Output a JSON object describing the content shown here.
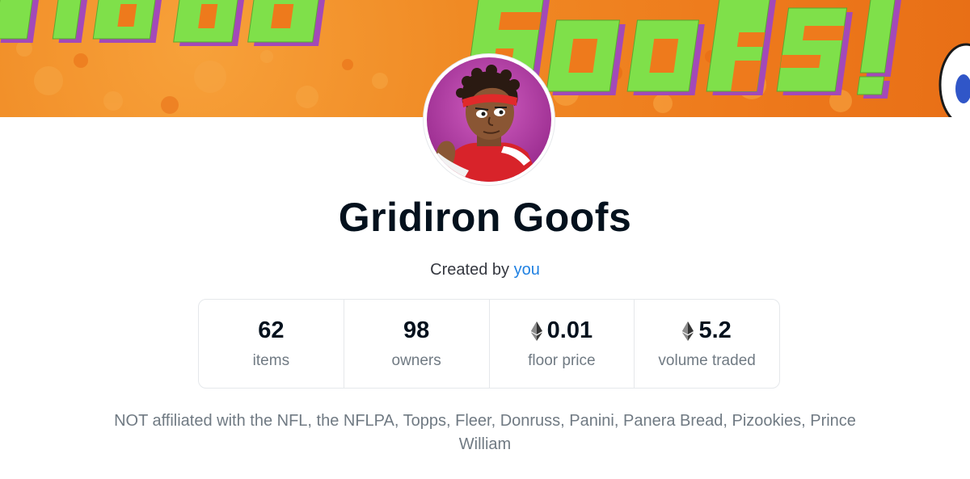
{
  "banner": {
    "text": "Gridiron Goofs!",
    "colors": {
      "background": "#ee7a1c",
      "letters": "#7fe04a",
      "shadow": "#a349b8"
    }
  },
  "collection": {
    "name": "Gridiron Goofs",
    "created_by_prefix": "Created by",
    "creator": "you"
  },
  "stats": [
    {
      "value": "62",
      "label": "items",
      "currency_icon": ""
    },
    {
      "value": "98",
      "label": "owners",
      "currency_icon": ""
    },
    {
      "value": "0.01",
      "label": "floor price",
      "currency_icon": "ethereum-icon"
    },
    {
      "value": "5.2",
      "label": "volume traded",
      "currency_icon": "ethereum-icon"
    }
  ],
  "description": "NOT affiliated with the NFL, the NFLPA, Topps, Fleer, Donruss, Panini, Panera Bread, Pizookies, Prince William",
  "colors": {
    "title": "#04111d",
    "link": "#2081e2",
    "muted": "#707a83",
    "border": "#e5e8eb"
  }
}
